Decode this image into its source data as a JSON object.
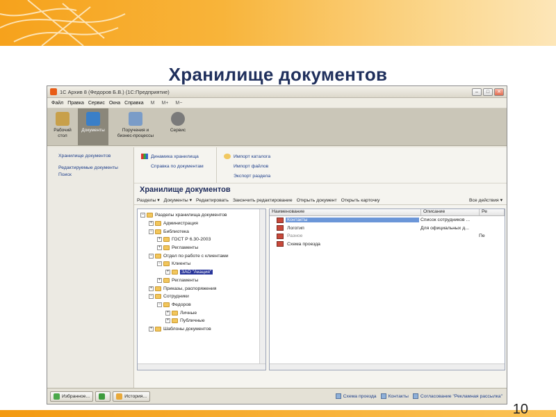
{
  "slide": {
    "title": "Хранилище документов",
    "page_number": "10",
    "accent_color": "#f6a21c"
  },
  "window": {
    "title": "1С Архив 8 (Федоров Б.В.) (1С:Предприятие)",
    "controls": [
      "–",
      "□",
      "✕"
    ]
  },
  "menu": [
    "Файл",
    "Правка",
    "Сервис",
    "Окна",
    "Справка"
  ],
  "menu_toolbar": [
    "M",
    "M+",
    "M−"
  ],
  "sections": [
    {
      "label1": "Рабочий",
      "label2": "стол",
      "icon": "desk-icon",
      "color": "#c8a04a"
    },
    {
      "label1": "Документы",
      "label2": "",
      "icon": "documents-icon",
      "color": "#3a7fc8",
      "active": true
    },
    {
      "label1": "Поручения и",
      "label2": "бизнес-процессы",
      "icon": "tasks-icon",
      "color": "#7a9cc8"
    },
    {
      "label1": "Сервис",
      "label2": "",
      "icon": "gear-icon",
      "color": "#7a7a7a"
    }
  ],
  "left_nav": [
    "Хранилище документов",
    "Редактируемые документы",
    "Поиск"
  ],
  "actions_col1": [
    "Динамика хранилища",
    "Справка по документам"
  ],
  "actions_col2": [
    "Импорт каталога",
    "Импорт файлов",
    "Экспорт раздела"
  ],
  "main_title": "Хранилище документов",
  "toolbar": [
    "Разделы ▾",
    "Документы ▾",
    "Редактировать",
    "Закончить редактирование",
    "Открыть документ",
    "Открыть карточку"
  ],
  "toolbar_more": "Все действия ▾",
  "tree": [
    {
      "t": "Разделы хранилища документов",
      "lvl": 0,
      "tog": "−"
    },
    {
      "t": "Администрация",
      "lvl": 1,
      "tog": "+"
    },
    {
      "t": "Библиотека",
      "lvl": 1,
      "tog": "−"
    },
    {
      "t": "ГОСТ Р 6.30-2003",
      "lvl": 2,
      "tog": "+"
    },
    {
      "t": "Регламенты",
      "lvl": 2,
      "tog": "+"
    },
    {
      "t": "Отдел по работе с клиентами",
      "lvl": 1,
      "tog": "−"
    },
    {
      "t": "Клиенты",
      "lvl": 2,
      "tog": "−"
    },
    {
      "t": "ЗАО \"Акация\"",
      "lvl": 3,
      "tog": "+",
      "selected": true
    },
    {
      "t": "Регламенты",
      "lvl": 2,
      "tog": "+"
    },
    {
      "t": "Приказы, распоряжения",
      "lvl": 1,
      "tog": "+"
    },
    {
      "t": "Сотрудники",
      "lvl": 1,
      "tog": "−"
    },
    {
      "t": "Федоров",
      "lvl": 2,
      "tog": "−"
    },
    {
      "t": "Личные",
      "lvl": 3,
      "tog": "+"
    },
    {
      "t": "Публичные",
      "lvl": 3,
      "tog": "+"
    },
    {
      "t": "Шаблоны документов",
      "lvl": 1,
      "tog": "+"
    }
  ],
  "list_headers": [
    "Наименование",
    "Описание",
    "Ре"
  ],
  "list_rows": [
    {
      "name": "Контакты",
      "desc": "Список сотрудников ...",
      "extra": "",
      "hl": true
    },
    {
      "name": "Логотип",
      "desc": "Для официальных д...",
      "extra": ""
    },
    {
      "name": "Разное",
      "desc": "",
      "extra": "Пе",
      "grey": true
    },
    {
      "name": "Схема проезда",
      "desc": "",
      "extra": ""
    }
  ],
  "status": {
    "favorites": "Избранное...",
    "history": "История...",
    "links": [
      "Схема проезда",
      "Контакты",
      "Согласование \"Рекламная рассылка\""
    ]
  }
}
